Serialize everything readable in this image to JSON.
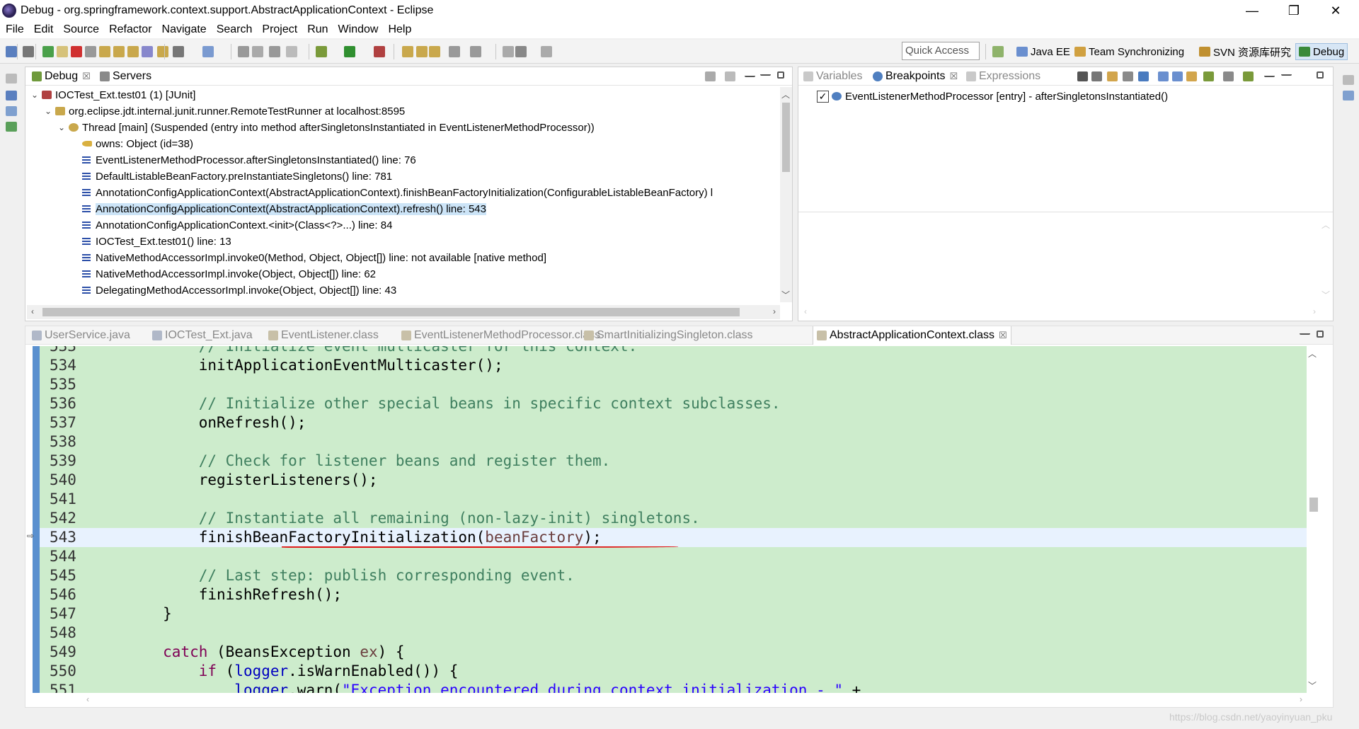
{
  "window": {
    "title": "Debug - org.springframework.context.support.AbstractApplicationContext - Eclipse",
    "minimize": "—",
    "restore": "❐",
    "close": "✕"
  },
  "menu": [
    "File",
    "Edit",
    "Source",
    "Refactor",
    "Navigate",
    "Search",
    "Project",
    "Run",
    "Window",
    "Help"
  ],
  "toolbar": {
    "quick_access": "Quick Access",
    "perspectives": [
      {
        "label": "Java EE",
        "color": "#6a8fcf"
      },
      {
        "label": "Team Synchronizing",
        "color": "#d0a040"
      },
      {
        "label": "SVN 资源库研究",
        "color": "#c09030"
      },
      {
        "label": "Debug",
        "color": "#3a8a3a"
      }
    ]
  },
  "debug_view": {
    "tabs": [
      {
        "label": "Debug",
        "close": "☒"
      },
      {
        "label": "Servers"
      }
    ],
    "tree": [
      {
        "indent": 0,
        "twisty": "⌄",
        "icon": "junit-icon",
        "text": "IOCTest_Ext.test01 (1) [JUnit]"
      },
      {
        "indent": 1,
        "twisty": "⌄",
        "icon": "process-icon",
        "text": "org.eclipse.jdt.internal.junit.runner.RemoteTestRunner at localhost:8595"
      },
      {
        "indent": 2,
        "twisty": "⌄",
        "icon": "thread-icon",
        "text": "Thread [main] (Suspended (entry into method afterSingletonsInstantiated in EventListenerMethodProcessor))"
      },
      {
        "indent": 3,
        "twisty": "",
        "icon": "key-icon",
        "text": "owns: Object  (id=38)"
      },
      {
        "indent": 3,
        "twisty": "",
        "icon": "stack-frame-icon",
        "text": "EventListenerMethodProcessor.afterSingletonsInstantiated() line: 76"
      },
      {
        "indent": 3,
        "twisty": "",
        "icon": "stack-frame-icon",
        "text": "DefaultListableBeanFactory.preInstantiateSingletons() line: 781"
      },
      {
        "indent": 3,
        "twisty": "",
        "icon": "stack-frame-icon",
        "text": "AnnotationConfigApplicationContext(AbstractApplicationContext).finishBeanFactoryInitialization(ConfigurableListableBeanFactory) l"
      },
      {
        "indent": 3,
        "twisty": "",
        "icon": "stack-frame-icon",
        "text": "AnnotationConfigApplicationContext(AbstractApplicationContext).refresh() line: 543",
        "selected": true
      },
      {
        "indent": 3,
        "twisty": "",
        "icon": "stack-frame-icon",
        "text": "AnnotationConfigApplicationContext.<init>(Class<?>...) line: 84"
      },
      {
        "indent": 3,
        "twisty": "",
        "icon": "stack-frame-icon",
        "text": "IOCTest_Ext.test01() line: 13"
      },
      {
        "indent": 3,
        "twisty": "",
        "icon": "stack-frame-icon",
        "text": "NativeMethodAccessorImpl.invoke0(Method, Object, Object[]) line: not available [native method]"
      },
      {
        "indent": 3,
        "twisty": "",
        "icon": "stack-frame-icon",
        "text": "NativeMethodAccessorImpl.invoke(Object, Object[]) line: 62"
      },
      {
        "indent": 3,
        "twisty": "",
        "icon": "stack-frame-icon",
        "text": "DelegatingMethodAccessorImpl.invoke(Object, Object[]) line: 43"
      }
    ]
  },
  "breakpoints_view": {
    "tabs": [
      {
        "label": "Variables"
      },
      {
        "label": "Breakpoints",
        "close": "☒"
      },
      {
        "label": "Expressions"
      }
    ],
    "items": [
      {
        "checked": "✓",
        "text": "EventListenerMethodProcessor [entry] - afterSingletonsInstantiated()"
      }
    ]
  },
  "editor": {
    "tabs": [
      {
        "label": "UserService.java"
      },
      {
        "label": "IOCTest_Ext.java"
      },
      {
        "label": "EventListener.class"
      },
      {
        "label": "EventListenerMethodProcessor.class"
      },
      {
        "label": "SmartInitializingSingleton.class"
      },
      {
        "label": "AbstractApplicationContext.class",
        "close": "☒"
      }
    ],
    "lines": [
      {
        "n": "533",
        "html": "<span class=\"cmt\">// Initialize event multicaster for this context.</span>",
        "indent": "            "
      },
      {
        "n": "534",
        "html": "initApplicationEventMulticaster();",
        "indent": "            "
      },
      {
        "n": "535",
        "html": "",
        "indent": ""
      },
      {
        "n": "536",
        "html": "<span class=\"cmt\">// Initialize other special beans in specific context subclasses.</span>",
        "indent": "            "
      },
      {
        "n": "537",
        "html": "onRefresh();",
        "indent": "            "
      },
      {
        "n": "538",
        "html": "",
        "indent": ""
      },
      {
        "n": "539",
        "html": "<span class=\"cmt\">// Check for listener beans and register them.</span>",
        "indent": "            "
      },
      {
        "n": "540",
        "html": "registerListeners();",
        "indent": "            "
      },
      {
        "n": "541",
        "html": "",
        "indent": ""
      },
      {
        "n": "542",
        "html": "<span class=\"cmt\">// Instantiate all remaining (non-lazy-init) singletons.</span>",
        "indent": "            "
      },
      {
        "n": "543",
        "html": "finishBeanFactoryInitialization(<span class=\"var\">beanFactory</span>);",
        "indent": "            ",
        "current": true
      },
      {
        "n": "544",
        "html": "",
        "indent": ""
      },
      {
        "n": "545",
        "html": "<span class=\"cmt\">// Last step: publish corresponding event.</span>",
        "indent": "            "
      },
      {
        "n": "546",
        "html": "finishRefresh();",
        "indent": "            "
      },
      {
        "n": "547",
        "html": "}",
        "indent": "        "
      },
      {
        "n": "548",
        "html": "",
        "indent": ""
      },
      {
        "n": "549",
        "html": "<span class=\"kw\">catch</span> (BeansException <span class=\"var\">ex</span>) {",
        "indent": "        "
      },
      {
        "n": "550",
        "html": "<span class=\"kw\">if</span> (<span class=\"fld\">logger</span>.isWarnEnabled()) {",
        "indent": "            "
      },
      {
        "n": "551",
        "html": "<span class=\"fld\">logger</span>.warn(<span class=\"str\">\"Exception encountered during context initialization - \"</span> +",
        "indent": "                "
      }
    ]
  },
  "watermark": "https://blog.csdn.net/yaoyinyuan_pku"
}
